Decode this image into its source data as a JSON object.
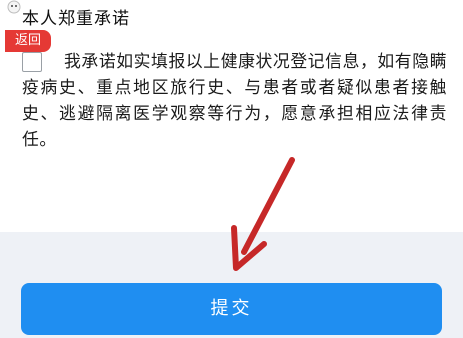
{
  "header": {
    "pledge_title": "本人郑重承诺"
  },
  "nav": {
    "back_label": "返回",
    "back_color": "#e53935"
  },
  "pledge": {
    "checked": false,
    "text": "我承诺如实填报以上健康状况登记信息，如有隐瞒疫病史、重点地区旅行史、与患者或者疑似患者接触史、逃避隔离医学观察等行为，愿意承担相应法律责任。"
  },
  "footer": {
    "submit_label": "提交",
    "submit_color": "#1f8ef1"
  },
  "annotation": {
    "arrow_color": "#c62828"
  }
}
